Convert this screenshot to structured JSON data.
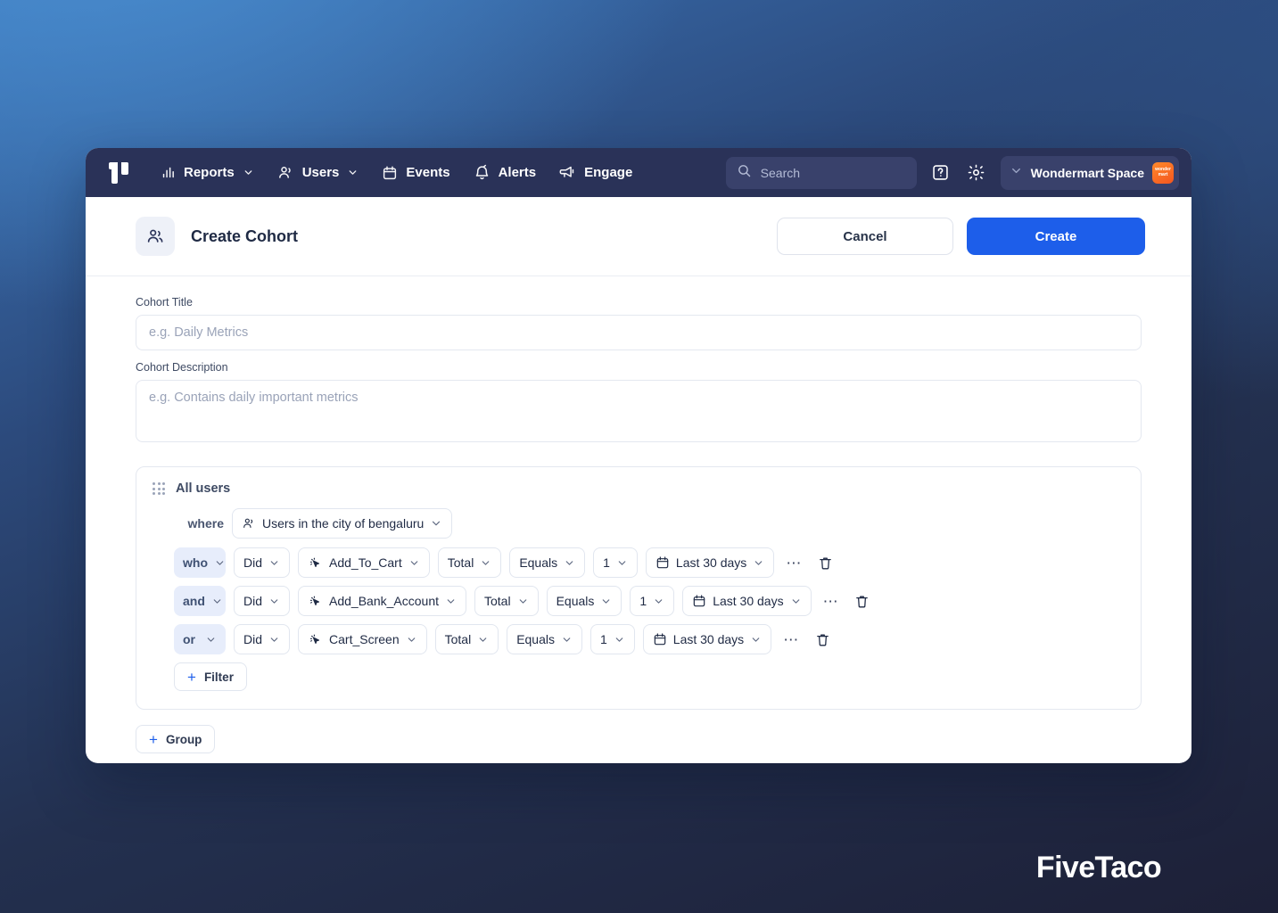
{
  "navbar": {
    "logo_name": "product-logo",
    "items": [
      {
        "label": "Reports",
        "icon": "bar-chart-icon",
        "has_chevron": true
      },
      {
        "label": "Users",
        "icon": "users-icon",
        "has_chevron": true
      },
      {
        "label": "Events",
        "icon": "calendar-icon",
        "has_chevron": false
      },
      {
        "label": "Alerts",
        "icon": "bell-icon",
        "has_chevron": false
      },
      {
        "label": "Engage",
        "icon": "megaphone-icon",
        "has_chevron": false
      }
    ],
    "search_placeholder": "Search",
    "help_icon": "help-question-icon",
    "settings_icon": "gear-icon",
    "space_name": "Wondermart Space",
    "space_avatar_text": "wonder mart"
  },
  "header": {
    "icon": "cohort-users-icon",
    "title": "Create Cohort",
    "cancel_label": "Cancel",
    "create_label": "Create"
  },
  "form": {
    "title_label": "Cohort Title",
    "title_placeholder": "e.g. Daily Metrics",
    "title_value": "",
    "description_label": "Cohort Description",
    "description_placeholder": "e.g. Contains daily important metrics",
    "description_value": ""
  },
  "group": {
    "name": "All users",
    "where_label": "where",
    "where_chip": "Users in the city of bengaluru",
    "rows": [
      {
        "logic": "who",
        "action": "Did",
        "event": "Add_To_Cart",
        "aggregate": "Total",
        "operator": "Equals",
        "value": "1",
        "date_range": "Last 30 days"
      },
      {
        "logic": "and",
        "action": "Did",
        "event": "Add_Bank_Account",
        "aggregate": "Total",
        "operator": "Equals",
        "value": "1",
        "date_range": "Last 30 days"
      },
      {
        "logic": "or",
        "action": "Did",
        "event": "Cart_Screen",
        "aggregate": "Total",
        "operator": "Equals",
        "value": "1",
        "date_range": "Last 30 days"
      }
    ],
    "add_filter_label": "Filter",
    "add_group_label": "Group"
  },
  "watermark": "FiveTaco",
  "colors": {
    "navbar_bg": "#2a3258",
    "primary": "#1d5eea",
    "logic_chip_bg": "#e7edfb",
    "accent_orange": "#f4551f"
  }
}
